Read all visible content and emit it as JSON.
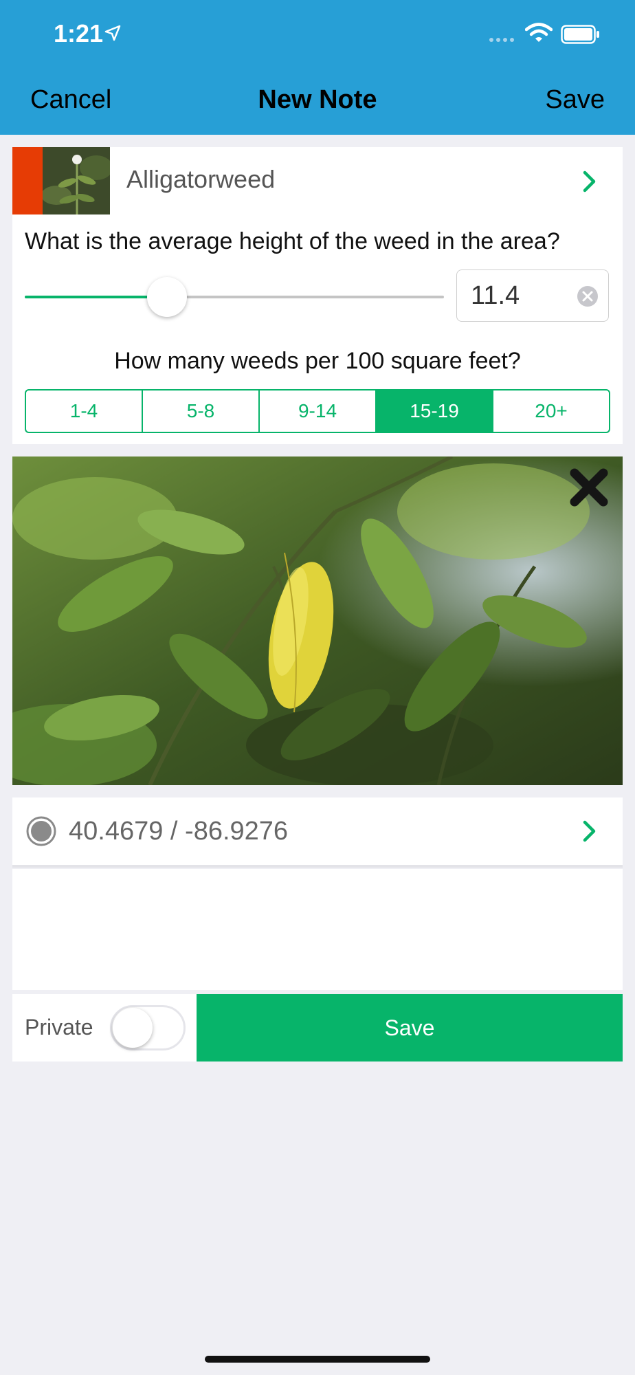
{
  "status_bar": {
    "time": "1:21"
  },
  "nav": {
    "cancel_label": "Cancel",
    "title": "New Note",
    "save_label": "Save"
  },
  "species": {
    "name": "Alligatorweed",
    "swatch_color": "#e63c05"
  },
  "height_question": {
    "label": "What is the average height of the weed in the area?",
    "value": "11.4",
    "slider_fraction": 0.34
  },
  "density_question": {
    "label": "How many weeds per 100 square feet?",
    "options": [
      "1-4",
      "5-8",
      "9-14",
      "15-19",
      "20+"
    ],
    "selected": "15-19"
  },
  "location": {
    "coords": "40.4679 / -86.9276"
  },
  "footer": {
    "private_label": "Private",
    "private_on": false,
    "save_label": "Save"
  },
  "colors": {
    "header": "#279fd6",
    "accent_green": "#07b46a",
    "background": "#efeff4"
  }
}
